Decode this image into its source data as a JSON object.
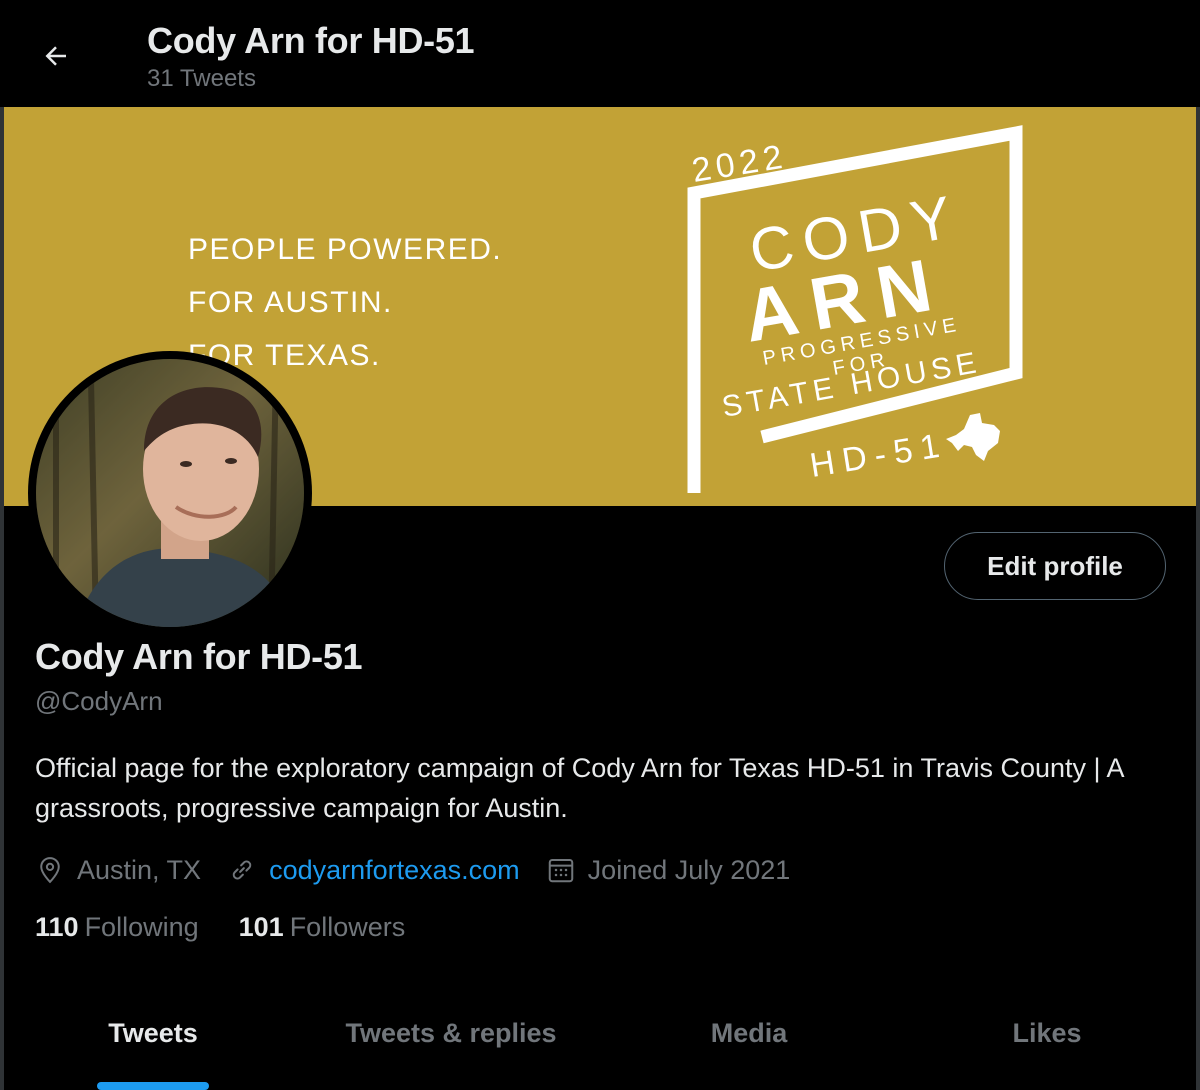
{
  "header": {
    "title": "Cody Arn for HD-51",
    "tweet_count": "31 Tweets"
  },
  "banner": {
    "slogan": [
      "PEOPLE POWERED.",
      "FOR AUSTIN.",
      "FOR TEXAS."
    ],
    "logo": {
      "year": "2022",
      "first_name": "CODY",
      "last_name": "ARN",
      "line1": "PROGRESSIVE",
      "line2": "FOR",
      "line3": "STATE HOUSE",
      "district": "HD-51"
    },
    "color": "#c2a236"
  },
  "profile": {
    "display_name": "Cody Arn for HD-51",
    "handle": "@CodyArn",
    "bio": "Official page for the exploratory campaign of Cody Arn for Texas HD-51 in Travis County | A grassroots, progressive campaign for Austin.",
    "location": "Austin, TX",
    "website": "codyarnfortexas.com",
    "joined": "Joined July 2021",
    "edit_label": "Edit profile"
  },
  "stats": {
    "following_count": "110",
    "following_label": "Following",
    "followers_count": "101",
    "followers_label": "Followers"
  },
  "tabs": [
    {
      "label": "Tweets",
      "active": true
    },
    {
      "label": "Tweets & replies",
      "active": false
    },
    {
      "label": "Media",
      "active": false
    },
    {
      "label": "Likes",
      "active": false
    }
  ],
  "colors": {
    "accent": "#1d9bf0",
    "muted_text": "#71767b",
    "background": "#000000"
  },
  "icons": [
    "back-arrow-icon",
    "location-pin-icon",
    "link-icon",
    "calendar-icon",
    "texas-state-icon"
  ]
}
